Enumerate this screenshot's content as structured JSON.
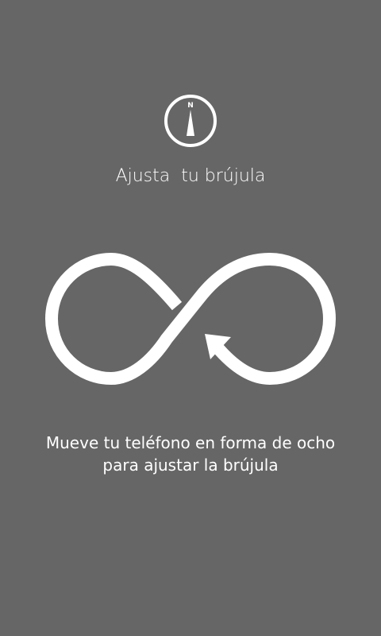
{
  "calibration": {
    "icon": "compass-icon",
    "compass_letter": "N",
    "title": "Ajusta  tu brújula",
    "instruction_line1": "Mueve tu teléfono en forma de ocho",
    "instruction_line2": "para ajustar la brújula",
    "gesture_icon": "figure-eight-motion-icon"
  },
  "colors": {
    "background": "#666666",
    "foreground": "#ffffff"
  }
}
